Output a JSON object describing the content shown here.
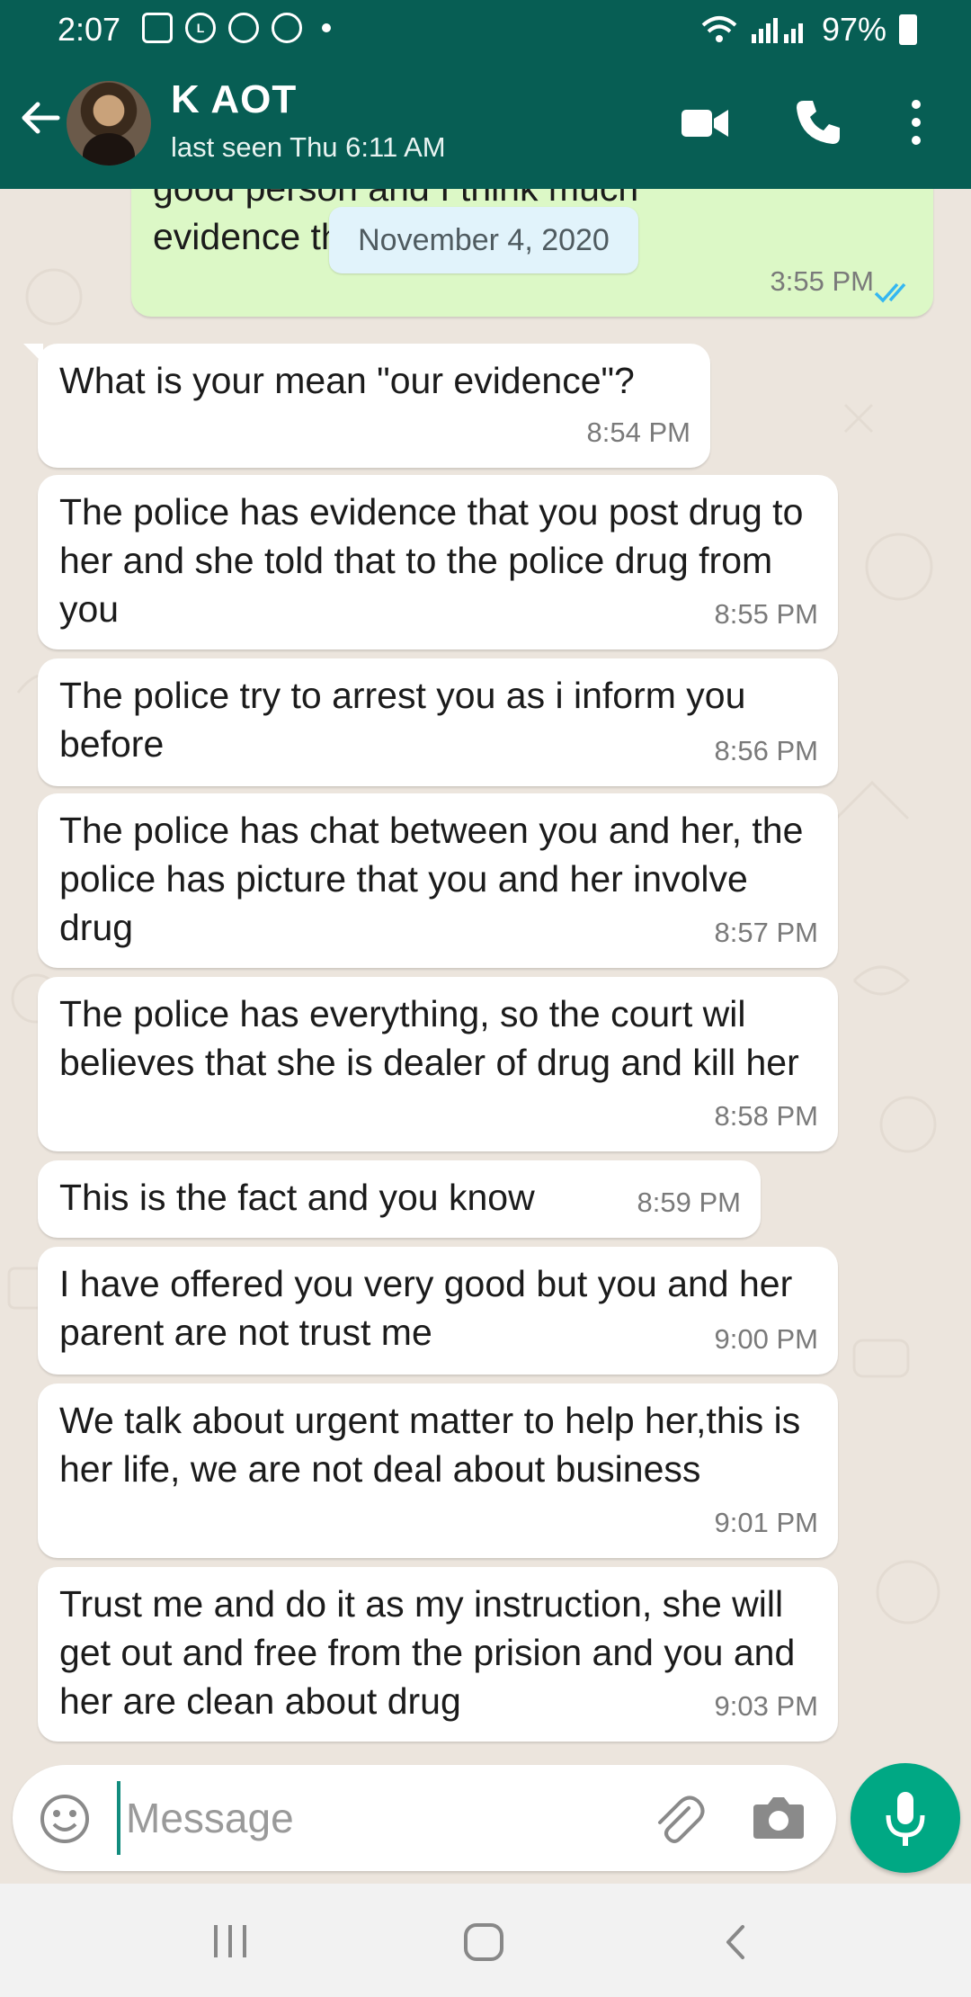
{
  "status_bar": {
    "time": "2:07",
    "battery": "97%",
    "notification_icons": [
      "image-icon",
      "line-icon",
      "chat-icon",
      "cloud-sync-icon"
    ]
  },
  "header": {
    "contact_name": "K AOT",
    "last_seen": "last seen Thu 6:11 AM"
  },
  "chat": {
    "date_chip": "November 4, 2020",
    "outgoing_partial": {
      "text_line1": "good person and I think much",
      "text_line2": "evidence that she is not guilty",
      "time": "3:55 PM"
    },
    "messages": [
      {
        "text": "What is your mean \"our evidence\"?",
        "time": "8:54 PM"
      },
      {
        "text": "The police has evidence that you post drug to her and she told that to the police drug from you",
        "time": "8:55 PM"
      },
      {
        "text": "The police try to arrest you as i inform you before",
        "time": "8:56 PM"
      },
      {
        "text": "The police has chat between you and her, the police has picture that you and her involve drug",
        "time": "8:57 PM"
      },
      {
        "text": "The police has everything, so the court wil believes that she is dealer of drug and kill her",
        "time": "8:58 PM"
      },
      {
        "text": "This is the fact and you know",
        "time": "8:59 PM"
      },
      {
        "text": "I have offered you very good but you and her parent are not trust me",
        "time": "9:00 PM"
      },
      {
        "text": "We talk about urgent matter to help her,this is her life, we are not deal about business",
        "time": "9:01 PM"
      },
      {
        "text": "Trust me and do it as my instruction, she will get out and free from the prision and you and her are clean about drug",
        "time": "9:03 PM"
      }
    ]
  },
  "input": {
    "placeholder": "Message",
    "value": ""
  },
  "colors": {
    "header": "#075e54",
    "outgoing_bubble": "#dcf8c6",
    "incoming_bubble": "#ffffff",
    "chat_background": "#ece5dd",
    "accent": "#00a884",
    "read_ticks": "#34b7f1"
  }
}
